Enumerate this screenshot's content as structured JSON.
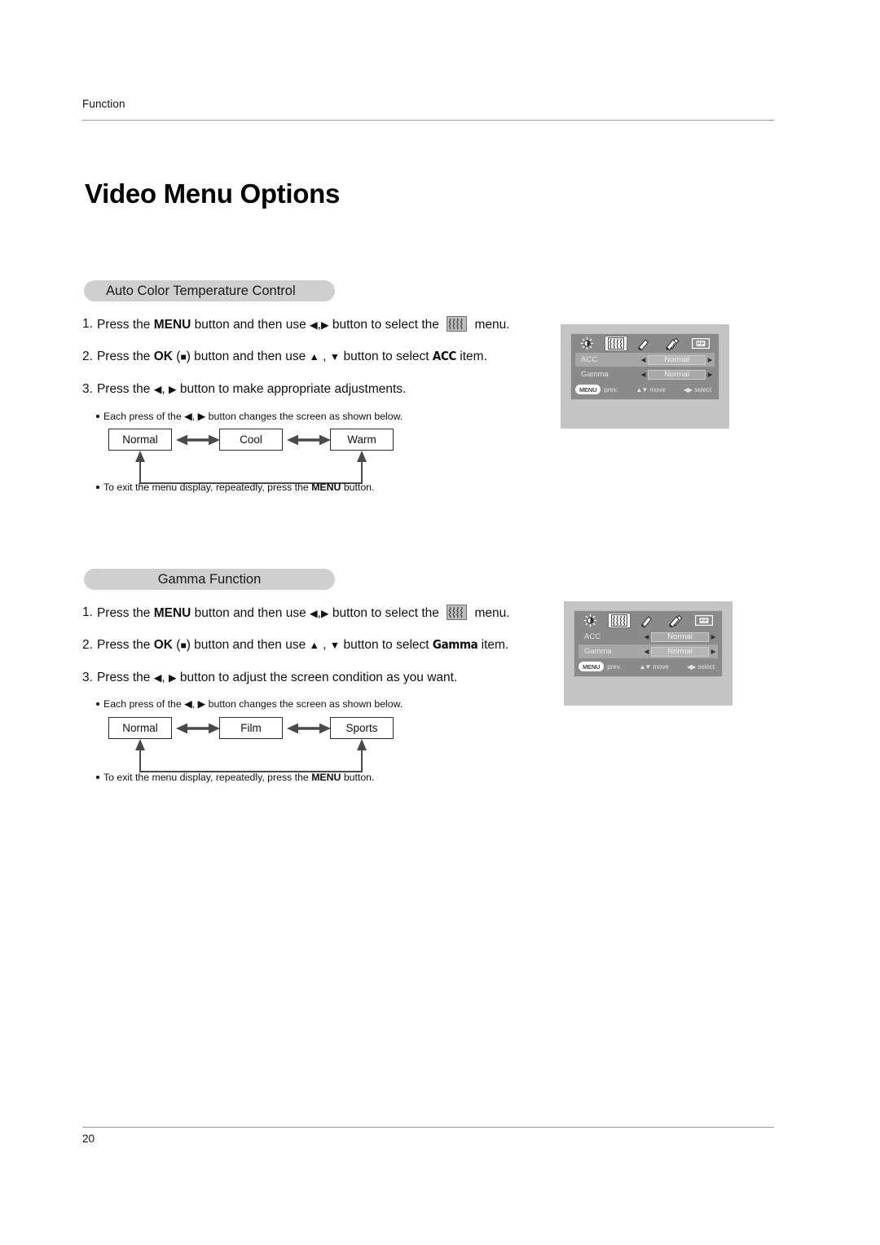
{
  "document": {
    "running_head": "Function",
    "page_title": "Video Menu Options",
    "page_number": "20"
  },
  "icons": {
    "menu_wavy": "wavy-bars-icon",
    "left_arrow": "◀",
    "right_arrow": "▶",
    "up_arrow": "▲",
    "down_arrow": "▼",
    "ok_square": "■"
  },
  "sections": [
    {
      "heading": "Auto Color Temperature Control",
      "heading_align": "left",
      "steps": [
        {
          "num": "1.",
          "parts": [
            {
              "t": "Press the ",
              "s": "n"
            },
            {
              "t": "MENU",
              "s": "b"
            },
            {
              "t": " button and then use ",
              "s": "n"
            },
            {
              "t": "◀",
              "s": "g"
            },
            {
              "t": ",",
              "s": "n"
            },
            {
              "t": "▶",
              "s": "g"
            },
            {
              "t": " button to select the ",
              "s": "n"
            },
            {
              "t": "",
              "s": "icon"
            },
            {
              "t": " menu.",
              "s": "n"
            }
          ]
        },
        {
          "num": "2.",
          "parts": [
            {
              "t": "Press the ",
              "s": "n"
            },
            {
              "t": "OK",
              "s": "b"
            },
            {
              "t": " (",
              "s": "n"
            },
            {
              "t": "■",
              "s": "sq"
            },
            {
              "t": ") button and then use ",
              "s": "n"
            },
            {
              "t": "▲",
              "s": "g"
            },
            {
              "t": " , ",
              "s": "n"
            },
            {
              "t": "▼",
              "s": "g"
            },
            {
              "t": " button to select ",
              "s": "n"
            },
            {
              "t": "ACC",
              "s": "c"
            },
            {
              "t": " item.",
              "s": "n"
            }
          ]
        },
        {
          "num": "3.",
          "parts": [
            {
              "t": "Press the ",
              "s": "n"
            },
            {
              "t": "◀",
              "s": "g"
            },
            {
              "t": ", ",
              "s": "n"
            },
            {
              "t": "▶",
              "s": "g"
            },
            {
              "t": " button to make appropriate adjustments.",
              "s": "n"
            }
          ]
        }
      ],
      "note_above": [
        {
          "t": "Each press of the ",
          "s": "n"
        },
        {
          "t": "◀",
          "s": "g"
        },
        {
          "t": ", ",
          "s": "n"
        },
        {
          "t": "▶",
          "s": "g"
        },
        {
          "t": " button changes the screen as shown below.",
          "s": "n"
        }
      ],
      "flow": [
        "Normal",
        "Cool",
        "Warm"
      ],
      "note_below": [
        {
          "t": "To exit the menu display, repeatedly, press the ",
          "s": "n"
        },
        {
          "t": "MENU",
          "s": "b"
        },
        {
          "t": " button.",
          "s": "n"
        }
      ],
      "osd": {
        "tabs": [
          "brightness-icon",
          "color-temperature-icon",
          "single-note-icon",
          "double-note-icon",
          "screen-mode-icon"
        ],
        "selected_tab_index": 1,
        "rows": [
          {
            "label": "ACC",
            "value": "Normal",
            "selected": true
          },
          {
            "label": "Gamma",
            "value": "Normal",
            "selected": false
          }
        ],
        "help": {
          "menu_chip": "MENU",
          "prev": "prev.",
          "move": "move",
          "select": "select",
          "move_arrows": "▲▼",
          "select_arrows": "◀▶"
        }
      }
    },
    {
      "heading": "Gamma Function",
      "heading_align": "center",
      "steps": [
        {
          "num": "1.",
          "parts": [
            {
              "t": "Press the ",
              "s": "n"
            },
            {
              "t": "MENU",
              "s": "b"
            },
            {
              "t": " button and then use ",
              "s": "n"
            },
            {
              "t": "◀",
              "s": "g"
            },
            {
              "t": ",",
              "s": "n"
            },
            {
              "t": "▶",
              "s": "g"
            },
            {
              "t": " button to select the ",
              "s": "n"
            },
            {
              "t": "",
              "s": "icon"
            },
            {
              "t": " menu.",
              "s": "n"
            }
          ]
        },
        {
          "num": "2.",
          "parts": [
            {
              "t": "Press the ",
              "s": "n"
            },
            {
              "t": "OK",
              "s": "b"
            },
            {
              "t": " (",
              "s": "n"
            },
            {
              "t": "■",
              "s": "sq"
            },
            {
              "t": ") button and then use ",
              "s": "n"
            },
            {
              "t": "▲",
              "s": "g"
            },
            {
              "t": " , ",
              "s": "n"
            },
            {
              "t": "▼",
              "s": "g"
            },
            {
              "t": " button to select ",
              "s": "n"
            },
            {
              "t": "Gamma",
              "s": "c"
            },
            {
              "t": " item.",
              "s": "n"
            }
          ]
        },
        {
          "num": "3.",
          "parts": [
            {
              "t": "Press the ",
              "s": "n"
            },
            {
              "t": "◀",
              "s": "g"
            },
            {
              "t": ", ",
              "s": "n"
            },
            {
              "t": "▶",
              "s": "g"
            },
            {
              "t": " button to adjust the screen condition as you want.",
              "s": "n"
            }
          ]
        }
      ],
      "note_above": [
        {
          "t": "Each press of the ",
          "s": "n"
        },
        {
          "t": "◀",
          "s": "g"
        },
        {
          "t": ", ",
          "s": "n"
        },
        {
          "t": "▶",
          "s": "g"
        },
        {
          "t": " button changes the screen as shown below.",
          "s": "n"
        }
      ],
      "flow": [
        "Normal",
        "Film",
        "Sports"
      ],
      "note_below": [
        {
          "t": "To exit the menu display, repeatedly, press the ",
          "s": "n"
        },
        {
          "t": "MENU",
          "s": "b"
        },
        {
          "t": " button.",
          "s": "n"
        }
      ],
      "osd": {
        "tabs": [
          "brightness-icon",
          "color-temperature-icon",
          "single-note-icon",
          "double-note-icon",
          "screen-mode-icon"
        ],
        "selected_tab_index": 1,
        "rows": [
          {
            "label": "ACC",
            "value": "Normal",
            "selected": false
          },
          {
            "label": "Gamma",
            "value": "Normal",
            "selected": true
          }
        ],
        "help": {
          "menu_chip": "MENU",
          "prev": "prev.",
          "move": "move",
          "select": "select",
          "move_arrows": "▲▼",
          "select_arrows": "◀▶"
        }
      }
    }
  ],
  "colors": {
    "pill_bg": "#cfcfcf",
    "rule": "#9a9a9a",
    "osd_screen": "#c4c4c4",
    "osd_panel": "#8a8a8a",
    "osd_row_selected": "#a6a6a6"
  }
}
